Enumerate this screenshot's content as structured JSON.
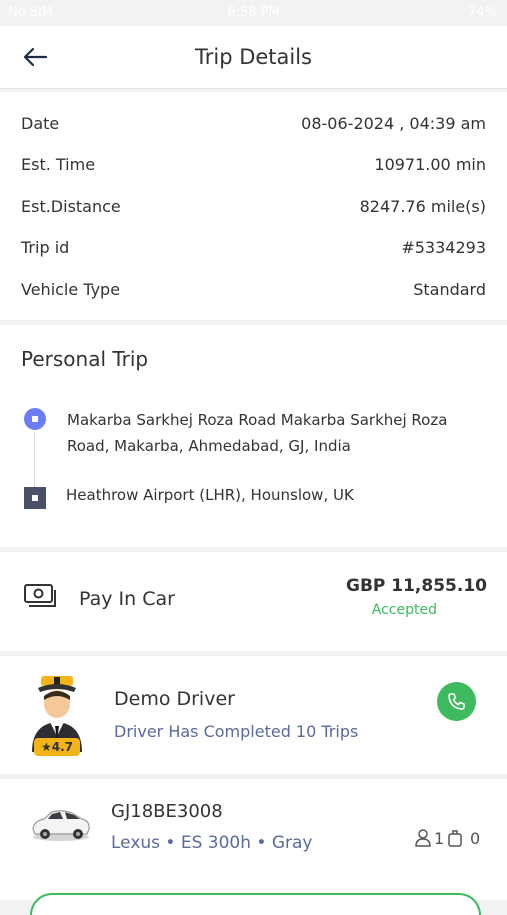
{
  "status_bar": {
    "carrier": "No SIM",
    "time": "6:58 PM",
    "battery": "74%"
  },
  "header": {
    "title": "Trip Details",
    "back_icon": "arrow-left-icon"
  },
  "trip_info": [
    {
      "label": "Date",
      "value": "08-06-2024 , 04:39 am"
    },
    {
      "label": "Est. Time",
      "value": "10971.00 min"
    },
    {
      "label": "Est.Distance",
      "value": "8247.76 mile(s)"
    },
    {
      "label": "Trip id",
      "value": "#5334293"
    },
    {
      "label": "Vehicle Type",
      "value": "Standard"
    }
  ],
  "route": {
    "title": "Personal Trip",
    "pickup_line1": "Makarba Sarkhej Roza Road Makarba Sarkhej Roza",
    "pickup_line2": "Road, Makarba, Ahmedabad, GJ, India",
    "dropoff": "Heathrow Airport (LHR), Hounslow, UK"
  },
  "payment": {
    "method": "Pay In Car",
    "amount": "GBP 11,855.10",
    "status": "Accepted",
    "icon": "cash-icon"
  },
  "driver": {
    "name": "Demo Driver",
    "subtitle": "Driver Has Completed 10 Trips",
    "rating": "★4.7",
    "call_icon": "phone-icon"
  },
  "vehicle": {
    "plate": "GJ18BE3008",
    "model": "Lexus • ES 300h • Gray",
    "passengers": "1",
    "luggage": "0"
  },
  "colors": {
    "accent": "#3dbb5e",
    "pickup": "#6b7cf5",
    "dropoff": "#4b5069",
    "subtitle": "#5a6a9c"
  }
}
